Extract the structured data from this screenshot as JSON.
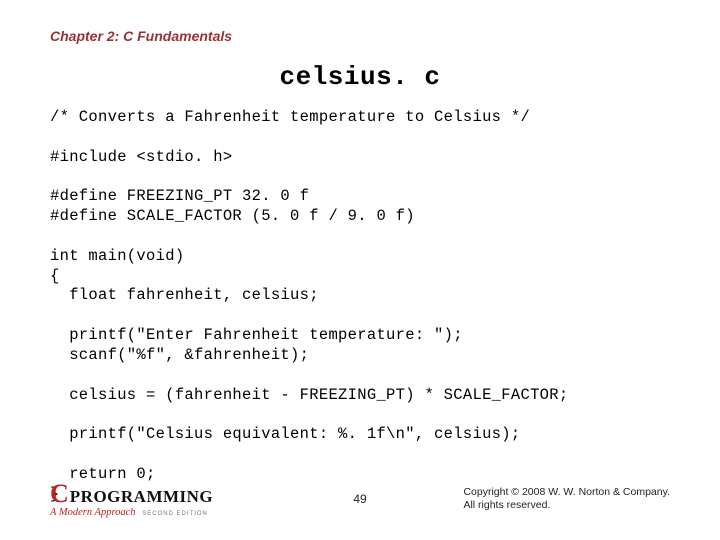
{
  "chapter": "Chapter 2: C Fundamentals",
  "title": "celsius. c",
  "code": "/* Converts a Fahrenheit temperature to Celsius */\n\n#include <stdio. h>\n\n#define FREEZING_PT 32. 0 f\n#define SCALE_FACTOR (5. 0 f / 9. 0 f)\n\nint main(void)\n{\n  float fahrenheit, celsius;\n\n  printf(\"Enter Fahrenheit temperature: \");\n  scanf(\"%f\", &fahrenheit);\n\n  celsius = (fahrenheit - FREEZING_PT) * SCALE_FACTOR;\n\n  printf(\"Celsius equivalent: %. 1f\\n\", celsius);\n\n  return 0;\n}",
  "footer": {
    "logo_c": "C",
    "logo_prog": "PROGRAMMING",
    "logo_sub": "A Modern Approach",
    "logo_ed": "SECOND EDITION",
    "page": "49",
    "copyright_l1": "Copyright © 2008 W. W. Norton & Company.",
    "copyright_l2": "All rights reserved."
  }
}
